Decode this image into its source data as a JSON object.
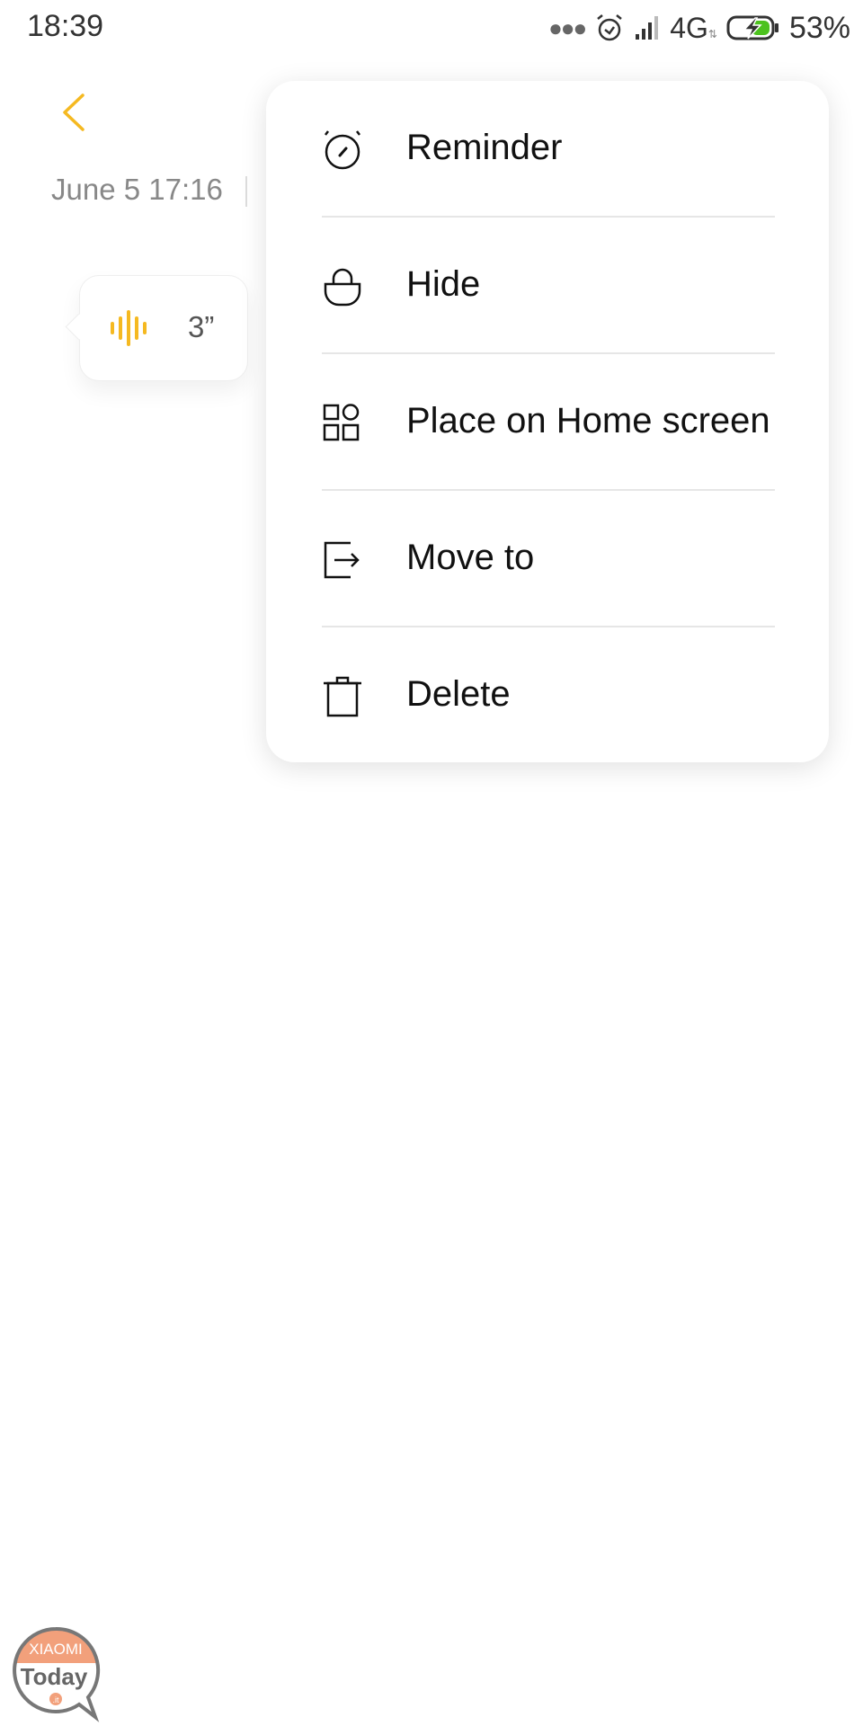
{
  "status_bar": {
    "time": "18:39",
    "network": "4G",
    "battery": "53%",
    "battery_level": 0.53,
    "icons": [
      "more-dots-icon",
      "alarm-icon",
      "signal-icon",
      "network-4g-icon",
      "battery-charging-icon"
    ]
  },
  "header": {
    "back_icon": "chevron-left-icon",
    "date": "June 5  17:16"
  },
  "voice_note": {
    "duration": "3”",
    "icon": "sound-wave-icon",
    "accent_color": "#F5B921"
  },
  "menu": {
    "items": [
      {
        "label": "Reminder",
        "icon": "alarm-clock-icon"
      },
      {
        "label": "Hide",
        "icon": "lock-icon"
      },
      {
        "label": "Place on Home screen",
        "icon": "widgets-icon"
      },
      {
        "label": "Move to",
        "icon": "move-folder-icon"
      },
      {
        "label": "Delete",
        "icon": "trash-icon"
      }
    ]
  },
  "watermark": {
    "line1": "XIAOMI",
    "line2": "Today",
    "line3": ".it"
  },
  "colors": {
    "accent": "#F5B921",
    "text_primary": "#111111",
    "text_secondary": "#888888",
    "battery_green": "#4CC21E"
  }
}
